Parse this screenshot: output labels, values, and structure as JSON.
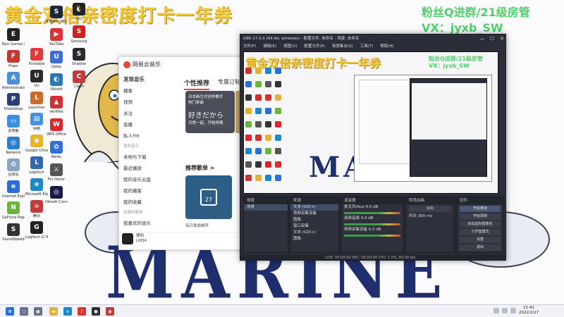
{
  "overlay": {
    "title": "黄金双倍亲密度打卡一年券",
    "group": "粉丝Q进群/21级房管",
    "vx": "VX：jyxb_SW"
  },
  "wallpaper": {
    "marine": "MARINE"
  },
  "desktop_icons_col1": [
    {
      "label": "EPIC",
      "sub": "Epic Games Launcher",
      "color": "#222222",
      "glyph": "E"
    },
    {
      "label": "",
      "sub": "Fraps",
      "color": "#c0392b",
      "glyph": "F"
    },
    {
      "label": "",
      "sub": "Administrator",
      "color": "#4a90d9",
      "glyph": "A"
    },
    {
      "label": "",
      "sub": "PhotoShop",
      "color": "#2c3e7a",
      "glyph": "P"
    },
    {
      "label": "",
      "sub": "此电脑",
      "color": "#3a8ee6",
      "glyph": "▭"
    },
    {
      "label": "",
      "sub": "Network",
      "color": "#2f7fd1",
      "glyph": "◎"
    },
    {
      "label": "",
      "sub": "回收站",
      "color": "#8aa4c4",
      "glyph": "♻"
    },
    {
      "label": "",
      "sub": "Internet Explorer",
      "color": "#2b6fd6",
      "glyph": "e"
    },
    {
      "label": "",
      "sub": "GeForce Experience",
      "color": "#6cb33f",
      "glyph": "N"
    },
    {
      "label": "",
      "sub": "SoundSpeed",
      "color": "#333333",
      "glyph": "S"
    }
  ],
  "desktop_icons_col2": [
    {
      "label": "",
      "sub": "Forzadjle",
      "color": "#e03a3a",
      "glyph": "F"
    },
    {
      "label": "",
      "sub": "UU",
      "color": "#2b2b2b",
      "glyph": "U"
    },
    {
      "label": "",
      "sub": "Launcher",
      "color": "#c96b2a",
      "glyph": "L"
    },
    {
      "label": "",
      "sub": "网络",
      "color": "#4a90d9",
      "glyph": "▤"
    },
    {
      "label": "",
      "sub": "Google Chrome",
      "color": "#e8b42c",
      "glyph": "◉"
    },
    {
      "label": "",
      "sub": "Logitech",
      "color": "#3366aa",
      "glyph": "L"
    },
    {
      "label": "",
      "sub": "Microsoft Edge",
      "color": "#1e88c9",
      "glyph": "e"
    },
    {
      "label": "",
      "sub": "腾讯",
      "color": "#c23b3b",
      "glyph": "☠"
    },
    {
      "label": "",
      "sub": "Logitech G HUB",
      "color": "#222222",
      "glyph": "G"
    }
  ],
  "desktop_icons_col3": [
    {
      "label": "",
      "sub": "STEAM OBS",
      "color": "#1b2838",
      "glyph": "S"
    },
    {
      "label": "",
      "sub": "YouTube",
      "color": "#d33",
      "glyph": "▶"
    },
    {
      "label": "",
      "sub": "Uplay",
      "color": "#3a6fd8",
      "glyph": "U"
    },
    {
      "label": "",
      "sub": "Ubisoft",
      "color": "#2a7ab0",
      "glyph": "◐"
    },
    {
      "label": "",
      "sub": "Verified",
      "color": "#d32f2f",
      "glyph": "▲"
    },
    {
      "label": "",
      "sub": "WPS Office",
      "color": "#d9262b",
      "glyph": "W"
    },
    {
      "label": "",
      "sub": "Baidu",
      "color": "#2f6fd8",
      "glyph": "✿"
    },
    {
      "label": "",
      "sub": "For Honor",
      "color": "#555555",
      "glyph": "⚔"
    },
    {
      "label": "",
      "sub": "Ubisoft Connect",
      "color": "#1a1a4a",
      "glyph": "◎"
    }
  ],
  "desktop_icons_col4": [
    {
      "label": "",
      "sub": "QQ",
      "color": "#222222",
      "glyph": "🐧"
    },
    {
      "label": "",
      "sub": "Samsung",
      "color": "#d02020",
      "glyph": "S"
    },
    {
      "label": "",
      "sub": "Shadow",
      "color": "#2a2a2a",
      "glyph": "S"
    },
    {
      "label": "",
      "sub": "Clash",
      "color": "#c23b3b",
      "glyph": "C"
    }
  ],
  "netease": {
    "logo": "网易云音乐",
    "sidebar": [
      {
        "label": "发现音乐",
        "active": true
      },
      {
        "label": "播客",
        "active": false
      },
      {
        "label": "视频",
        "active": false
      },
      {
        "label": "关注",
        "active": false
      },
      {
        "label": "直播",
        "active": false
      },
      {
        "label": "私人FM",
        "active": false
      }
    ],
    "my_music_header": "我的音乐",
    "my_music": [
      "本地与下载",
      "最近播放",
      "我的音乐云盘",
      "我的播客",
      "我的收藏"
    ],
    "playlists_header": "创建的歌单",
    "playlists": [
      "我喜欢的音乐"
    ],
    "tabs": [
      {
        "label": "个性推荐",
        "active": true
      },
      {
        "label": "专属订制",
        "active": false
      },
      {
        "label": "歌",
        "active": false
      }
    ],
    "banner_line1": "日本新生代创作歌手",
    "banner_line2": "热门单曲",
    "banner_big": "好きだから",
    "banner_sub": "日常一起，开始伴随",
    "rec_header": "推荐歌单 >",
    "card_day": "27",
    "card_label": "每日歌曲推荐",
    "user_name": "哪知",
    "user_sub": "LKPJ4"
  },
  "obs": {
    "title": "OBS 27.0.0 (64-bit, windows) - 配置文件: 未命名 - 场景: 未命名",
    "min": "—",
    "max": "☐",
    "close": "✕",
    "menu": [
      "文件(F)",
      "编辑(E)",
      "视图(V)",
      "配置文件(P)",
      "场景集合(S)",
      "工具(T)",
      "帮助(H)"
    ],
    "preview_title": "黄金双倍亲密度打卡一年券",
    "preview_group": "粉丝Q进群/21级房管",
    "preview_vx": "VX：jyxb_SW",
    "preview_marine": "MARINE",
    "docks": {
      "scenes_header": "场景",
      "scenes": [
        "场景"
      ],
      "sources_header": "来源",
      "sources": [
        "文本 (GDI+)",
        "视频采集设备",
        "图像",
        "窗口采集",
        "文本 (GDI+)",
        "图像"
      ],
      "mixer_header": "混音器",
      "mixer": [
        {
          "name": "麦克风/Aux",
          "level": "0.0 dB"
        },
        {
          "name": "桌面音频",
          "level": "0.0 dB"
        },
        {
          "name": "视频采集设备",
          "level": "0.0 dB"
        }
      ],
      "transitions_header": "转场动画",
      "transition_value": "淡出",
      "duration_label": "时长",
      "duration_value": "300 ms",
      "controls_header": "控件",
      "controls": [
        "开始推流",
        "开始录制",
        "启动虚拟摄像机",
        "工作室模式",
        "设置",
        "退出"
      ]
    },
    "status": "LIVE: 00:00:00    REC: 00:00:00    CPU: 1.0%, 60.00 fps"
  },
  "taskbar": {
    "time": "21:41",
    "date": "2022/2/27",
    "icons": [
      {
        "name": "windows-start",
        "color": "#2a6fd6",
        "glyph": "⊞"
      },
      {
        "name": "search",
        "color": "#667088",
        "glyph": "○"
      },
      {
        "name": "task-view",
        "color": "#667088",
        "glyph": "▣"
      },
      {
        "name": "file-explorer",
        "color": "#e0b33a",
        "glyph": "▬"
      },
      {
        "name": "edge",
        "color": "#1e88c9",
        "glyph": "e"
      },
      {
        "name": "netease-music",
        "color": "#d33",
        "glyph": "♪"
      },
      {
        "name": "obs",
        "color": "#333",
        "glyph": "●"
      },
      {
        "name": "app-red",
        "color": "#c23b3b",
        "glyph": "◉"
      }
    ]
  }
}
